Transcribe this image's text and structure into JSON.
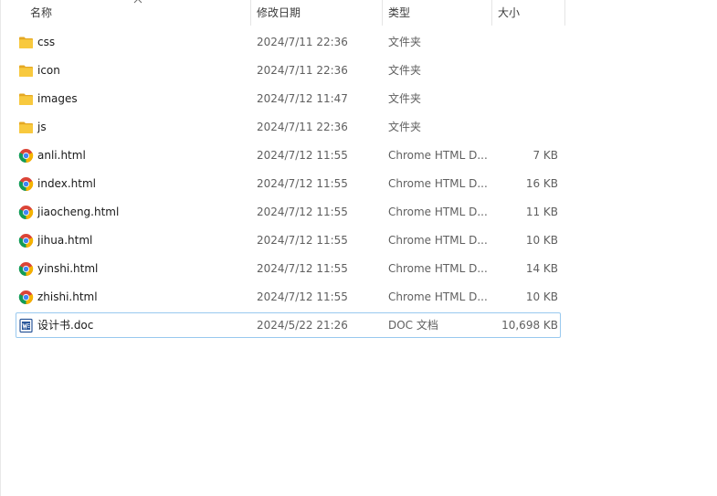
{
  "columns": {
    "name": "名称",
    "modified": "修改日期",
    "type": "类型",
    "size": "大小"
  },
  "files": [
    {
      "name": "css",
      "modified": "2024/7/11 22:36",
      "type": "文件夹",
      "size": "",
      "icon": "folder-icon"
    },
    {
      "name": "icon",
      "modified": "2024/7/11 22:36",
      "type": "文件夹",
      "size": "",
      "icon": "folder-icon"
    },
    {
      "name": "images",
      "modified": "2024/7/12 11:47",
      "type": "文件夹",
      "size": "",
      "icon": "folder-icon"
    },
    {
      "name": "js",
      "modified": "2024/7/11 22:36",
      "type": "文件夹",
      "size": "",
      "icon": "folder-icon"
    },
    {
      "name": "anli.html",
      "modified": "2024/7/12 11:55",
      "type": "Chrome HTML D...",
      "size": "7 KB",
      "icon": "chrome-icon"
    },
    {
      "name": "index.html",
      "modified": "2024/7/12 11:55",
      "type": "Chrome HTML D...",
      "size": "16 KB",
      "icon": "chrome-icon"
    },
    {
      "name": "jiaocheng.html",
      "modified": "2024/7/12 11:55",
      "type": "Chrome HTML D...",
      "size": "11 KB",
      "icon": "chrome-icon"
    },
    {
      "name": "jihua.html",
      "modified": "2024/7/12 11:55",
      "type": "Chrome HTML D...",
      "size": "10 KB",
      "icon": "chrome-icon"
    },
    {
      "name": "yinshi.html",
      "modified": "2024/7/12 11:55",
      "type": "Chrome HTML D...",
      "size": "14 KB",
      "icon": "chrome-icon"
    },
    {
      "name": "zhishi.html",
      "modified": "2024/7/12 11:55",
      "type": "Chrome HTML D...",
      "size": "10 KB",
      "icon": "chrome-icon"
    },
    {
      "name": "设计书.doc",
      "modified": "2024/5/22 21:26",
      "type": "DOC 文档",
      "size": "10,698 KB",
      "icon": "word-doc-icon"
    }
  ],
  "selected_file": "设计书.doc",
  "colors": {
    "folder": "#f8c93e",
    "folder_dark": "#e5a823",
    "selection_border": "#99c9ef",
    "doc_blue": "#2b579a"
  }
}
